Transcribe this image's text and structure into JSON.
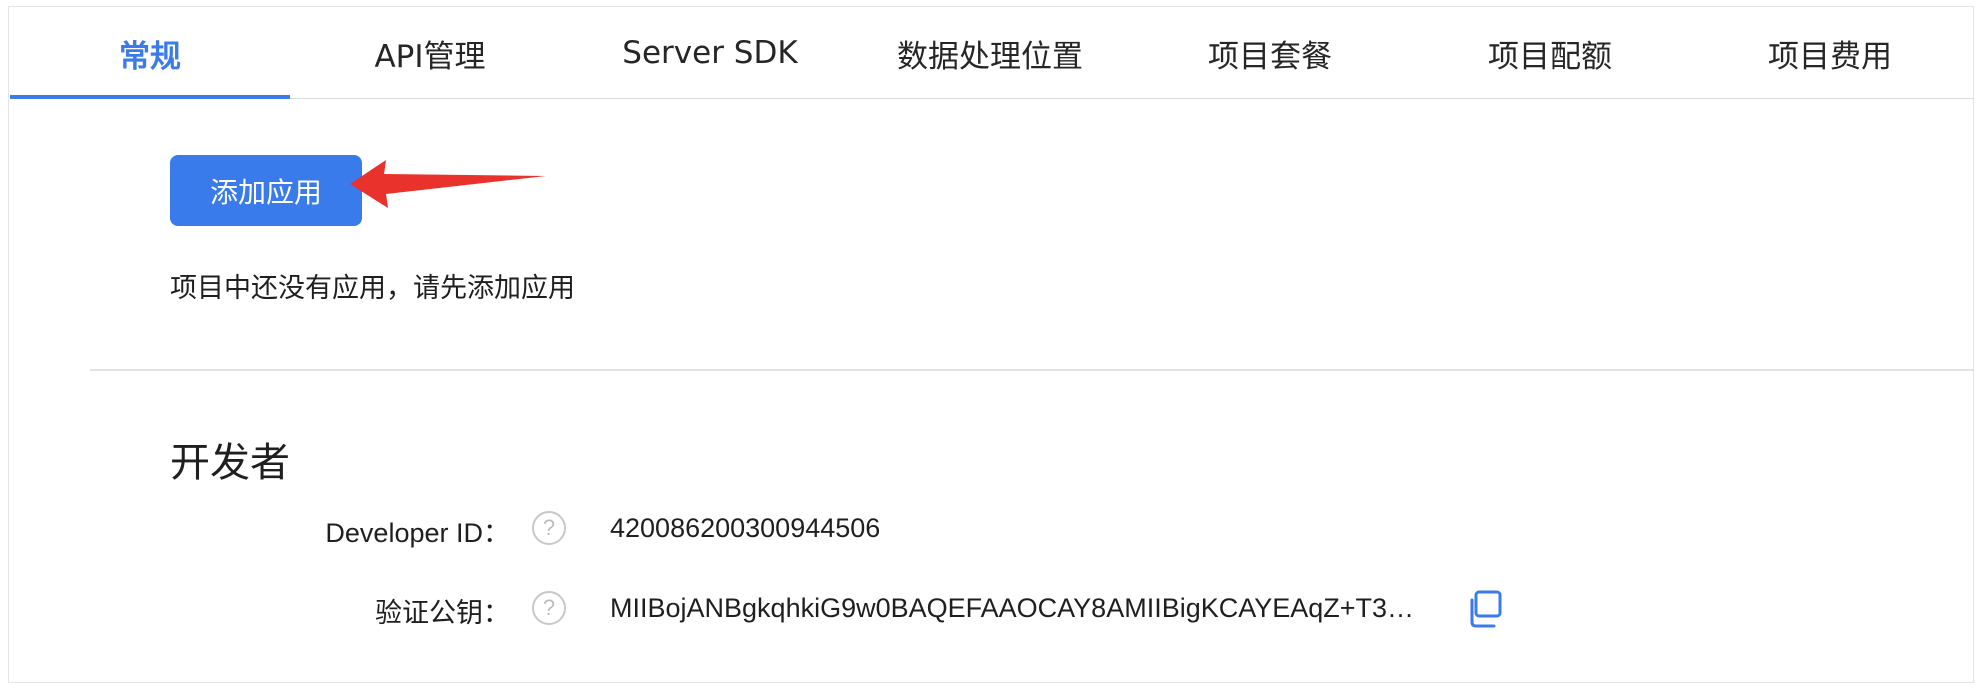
{
  "tabs": [
    {
      "label": "常规",
      "active": true
    },
    {
      "label": "API管理",
      "active": false
    },
    {
      "label": "Server SDK",
      "active": false
    },
    {
      "label": "数据处理位置",
      "active": false
    },
    {
      "label": "项目套餐",
      "active": false
    },
    {
      "label": "项目配额",
      "active": false
    },
    {
      "label": "项目费用",
      "active": false
    }
  ],
  "apps": {
    "add_button_label": "添加应用",
    "empty_message": "项目中还没有应用，请先添加应用"
  },
  "developer": {
    "section_title": "开发者",
    "developer_id_label": "Developer ID：",
    "developer_id_value": "420086200300944506",
    "public_key_label": "验证公钥：",
    "public_key_value": "MIIBojANBgkqhkiG9w0BAQEFAAOCAY8AMIIBigKCAYEAqZ+T3…",
    "help_glyph": "?"
  },
  "colors": {
    "accent": "#3a7bec",
    "annotation_arrow": "#e8322b"
  },
  "icons": {
    "help": "question-circle-icon",
    "copy": "copy-icon",
    "annotation": "red-arrow"
  }
}
